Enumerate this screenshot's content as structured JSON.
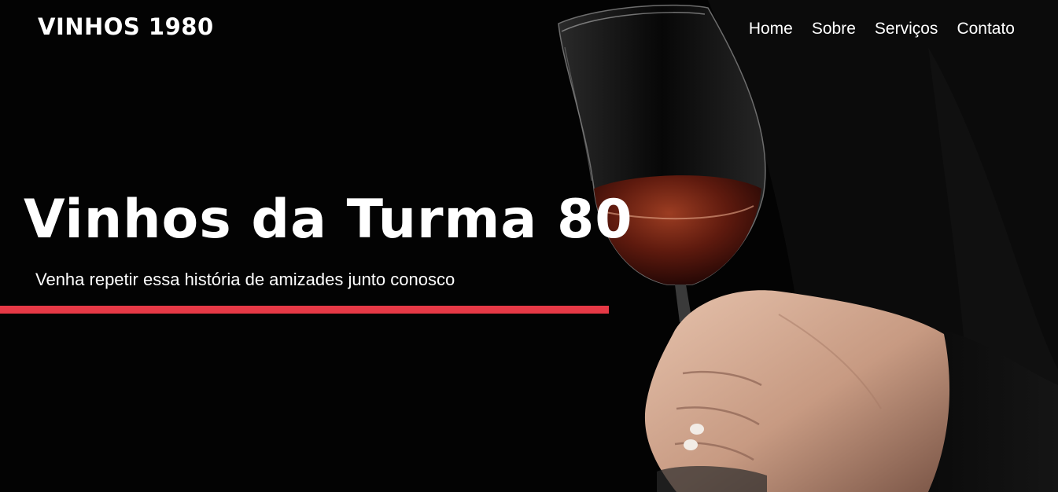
{
  "nav": {
    "brand": "VINHOS 1980",
    "links": [
      {
        "label": "Home"
      },
      {
        "label": "Sobre"
      },
      {
        "label": "Serviços"
      },
      {
        "label": "Contato"
      }
    ]
  },
  "hero": {
    "title": "Vinhos da Turma 80",
    "subtitle": "Venha repetir essa história de amizades junto conosco",
    "background_image": "hand-holding-wine-glass-photo"
  },
  "colors": {
    "accent": "#e63946",
    "background": "#030303",
    "text": "#ffffff"
  }
}
